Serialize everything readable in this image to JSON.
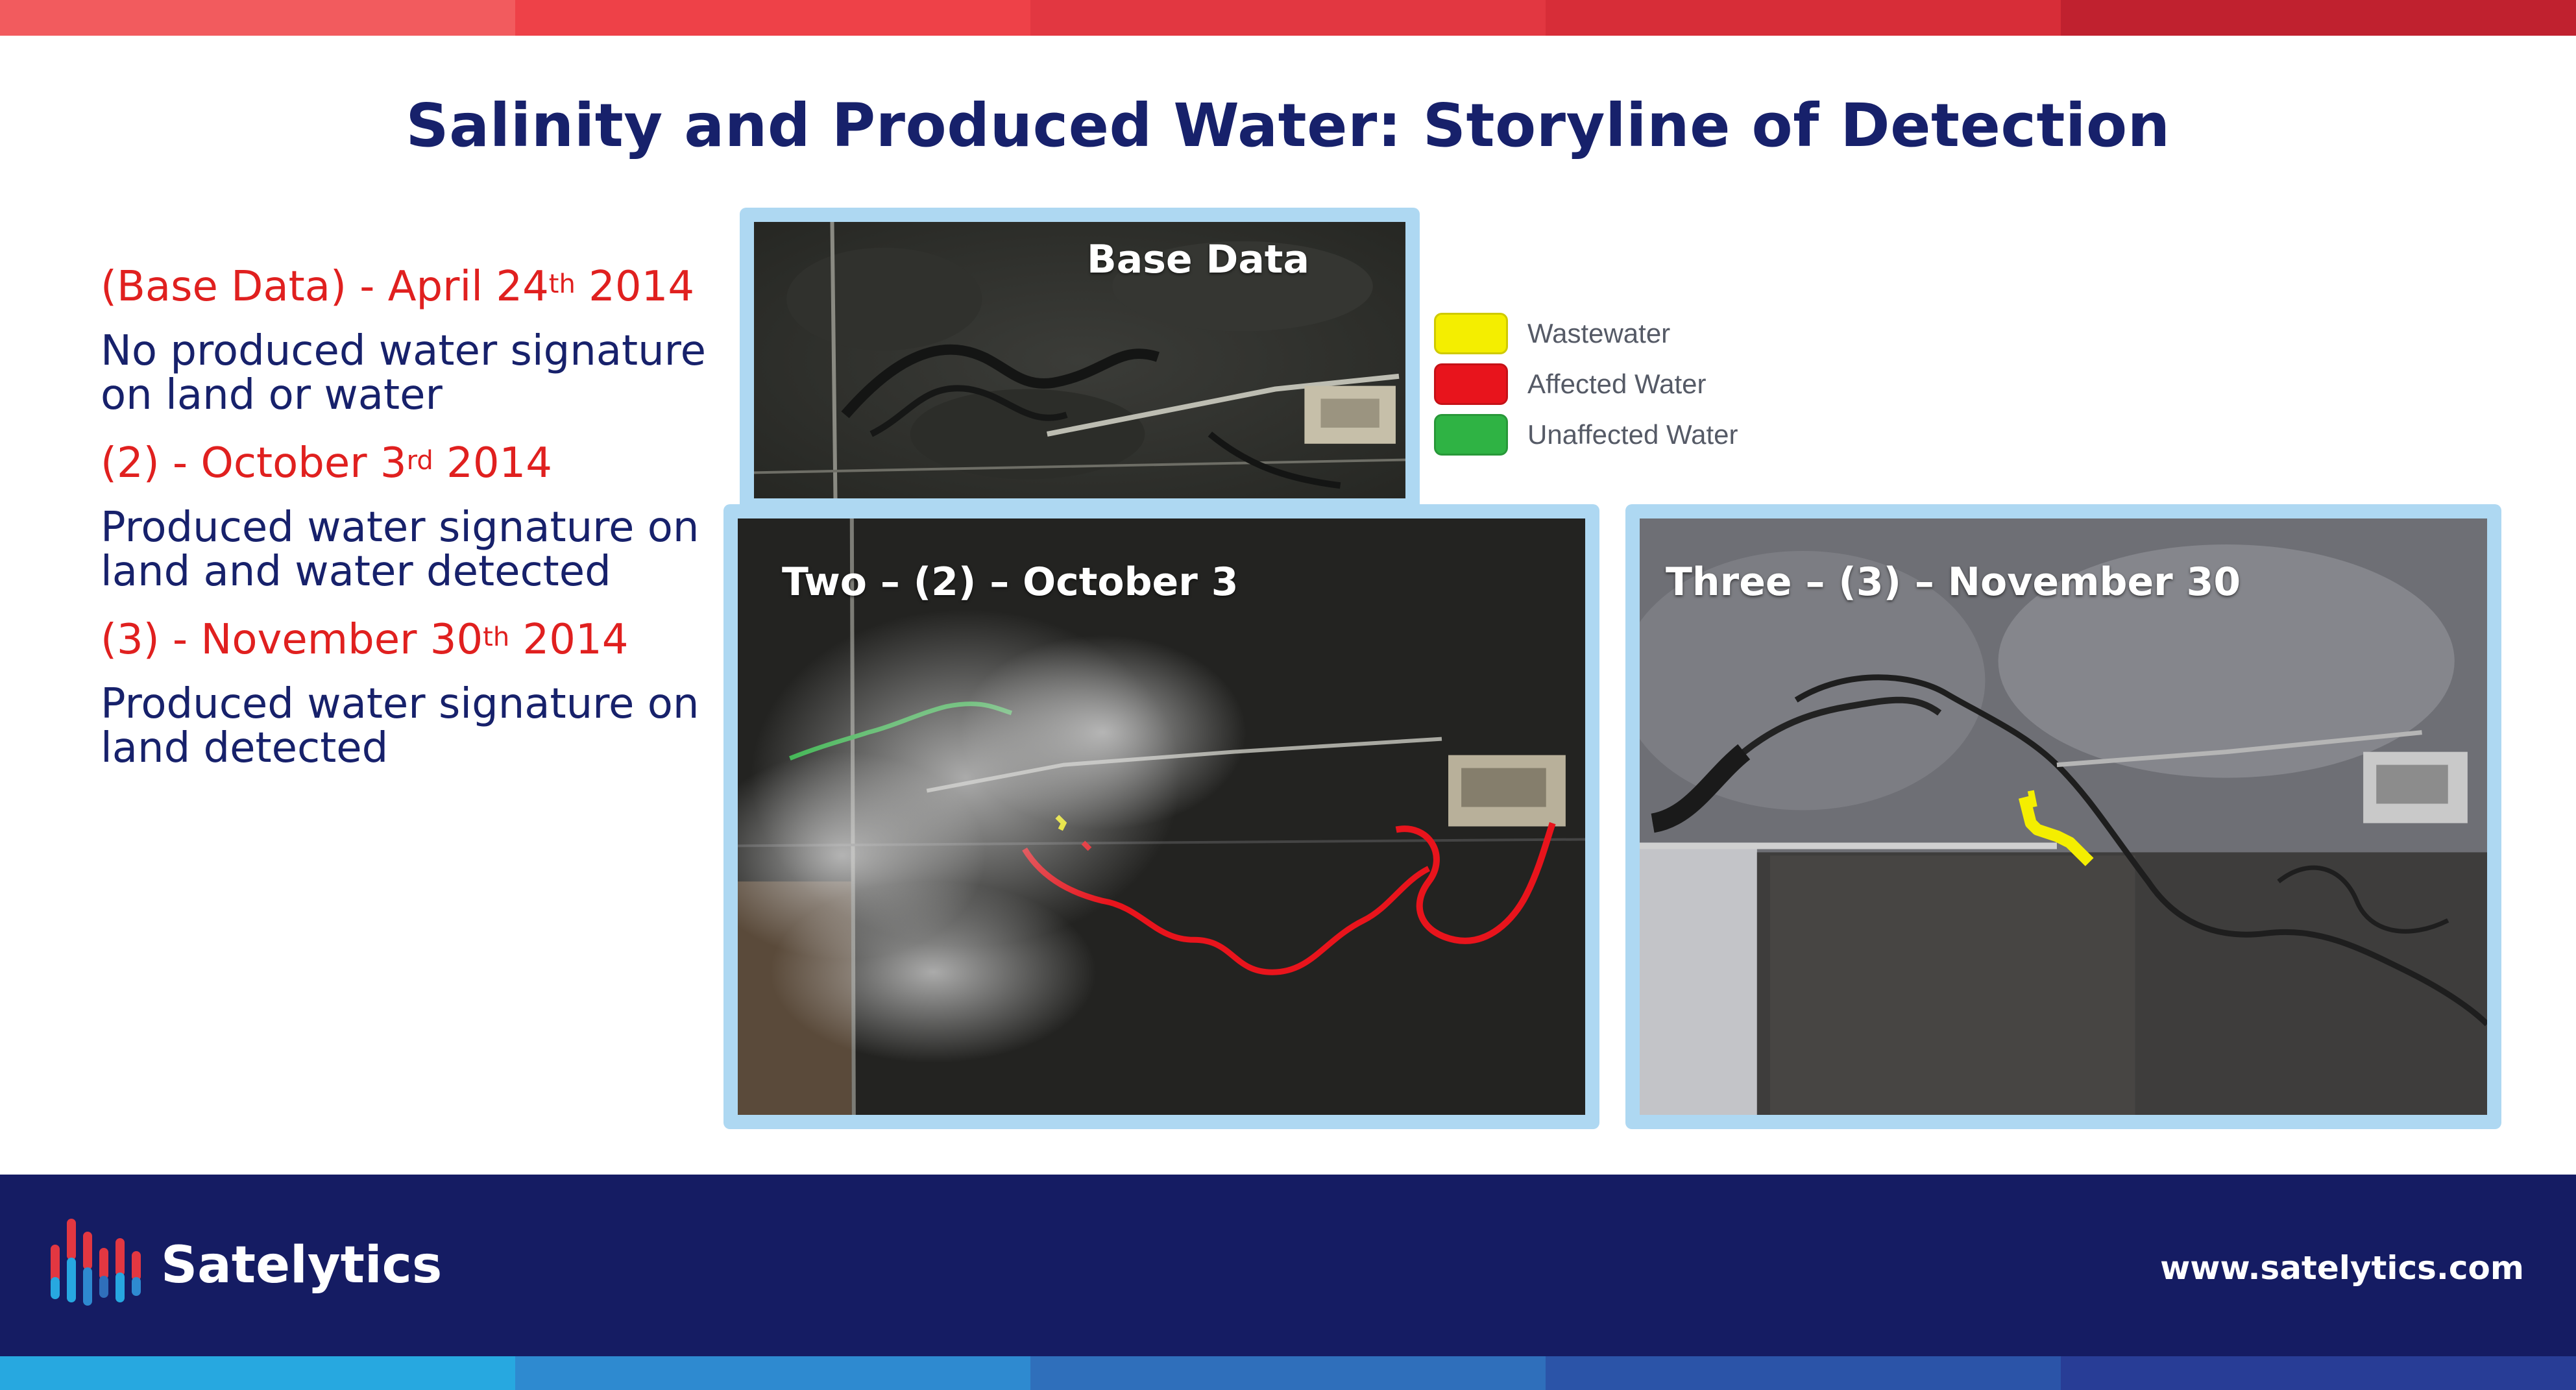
{
  "colors": {
    "top_bar": [
      "#f25b5e",
      "#ee4148",
      "#e23741",
      "#d72d38",
      "#c0212f"
    ],
    "bottom_bar": [
      "#27a8e0",
      "#2e8ad0",
      "#2f6fbb",
      "#2b54a8",
      "#283d96"
    ],
    "title": "#17216b",
    "date_red": "#e0201f",
    "frame": "#aed8f2",
    "footer": "#151c63"
  },
  "title": "Salinity and Produced Water: Storyline of Detection",
  "timeline": [
    {
      "date_prefix": "(Base Data) - April 24",
      "date_sup": "th",
      "date_suffix": " 2014",
      "description": "No produced water signature on land or water"
    },
    {
      "date_prefix": "(2) - October 3",
      "date_sup": "rd",
      "date_suffix": " 2014",
      "description": "Produced water signature on land and water detected"
    },
    {
      "date_prefix": "(3) - November 30",
      "date_sup": "th",
      "date_suffix": " 2014",
      "description": "Produced water signature on land detected"
    }
  ],
  "images": {
    "base": {
      "label": "Base Data"
    },
    "two": {
      "label": "Two – (2) – October 3"
    },
    "three": {
      "label": "Three – (3) – November 30"
    }
  },
  "legend": [
    {
      "label": "Wastewater",
      "color": "#f4ee00"
    },
    {
      "label": "Affected Water",
      "color": "#e8141c"
    },
    {
      "label": "Unaffected Water",
      "color": "#2fb344"
    }
  ],
  "footer": {
    "brand": "Satelytics",
    "url": "www.satelytics.com",
    "logo_icon": "satelytics-bars-logo-icon"
  }
}
